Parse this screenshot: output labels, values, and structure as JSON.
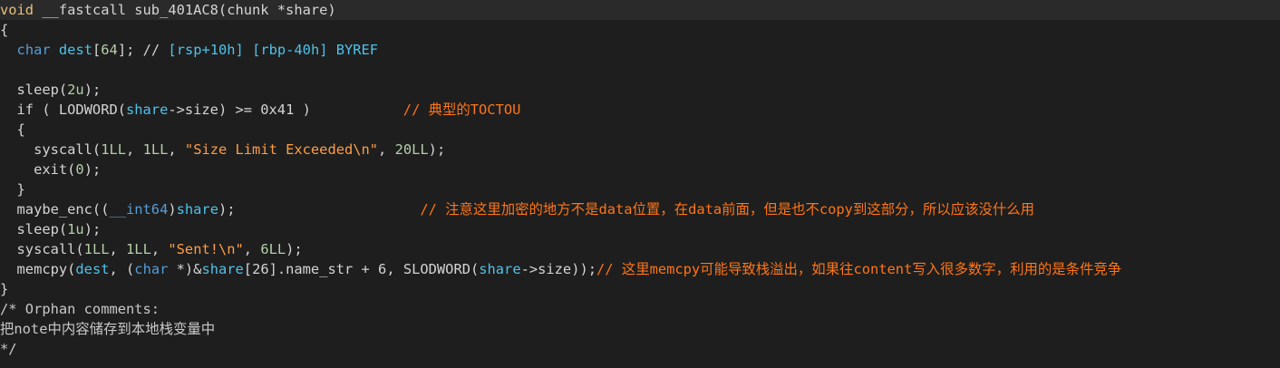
{
  "colors": {
    "background": "#1e1e1e",
    "text": "#d4d4d4",
    "keyword": "#e6c07b",
    "number": "#b5cea8",
    "identifier": "#4fc1e9",
    "string": "#ff9d45",
    "comment": "#ff7518",
    "highlight_line": "#2a2a2a"
  },
  "lines": [
    [
      [
        "kw",
        "void"
      ],
      [
        "plain",
        " __fastcall sub_401AC8(chunk *share)"
      ]
    ],
    [
      [
        "plain",
        "{"
      ]
    ],
    [
      [
        "plain",
        "  "
      ],
      [
        "type",
        "char"
      ],
      [
        "plain",
        " "
      ],
      [
        "var",
        "dest"
      ],
      [
        "plain",
        "["
      ],
      [
        "num",
        "64"
      ],
      [
        "plain",
        "]; // "
      ],
      [
        "var",
        "[rsp+10h] [rbp-40h] BYREF"
      ]
    ],
    [],
    [
      [
        "plain",
        "  sleep("
      ],
      [
        "num",
        "2u"
      ],
      [
        "plain",
        ");"
      ]
    ],
    [
      [
        "plain",
        "  if ( LODWORD("
      ],
      [
        "var",
        "share"
      ],
      [
        "plain",
        "->size) >= 0x41 )           "
      ],
      [
        "com",
        "// 典型的TOCTOU"
      ]
    ],
    [
      [
        "plain",
        "  {"
      ]
    ],
    [
      [
        "plain",
        "    syscall("
      ],
      [
        "num",
        "1LL"
      ],
      [
        "plain",
        ", "
      ],
      [
        "num",
        "1LL"
      ],
      [
        "plain",
        ", "
      ],
      [
        "str",
        "\"Size Limit Exceeded\\n\""
      ],
      [
        "plain",
        ", "
      ],
      [
        "num",
        "20LL"
      ],
      [
        "plain",
        ");"
      ]
    ],
    [
      [
        "plain",
        "    exit("
      ],
      [
        "num",
        "0"
      ],
      [
        "plain",
        ");"
      ]
    ],
    [
      [
        "plain",
        "  }"
      ]
    ],
    [
      [
        "plain",
        "  maybe_enc(("
      ],
      [
        "type",
        "__int64"
      ],
      [
        "plain",
        ")"
      ],
      [
        "var",
        "share"
      ],
      [
        "plain",
        ");                      "
      ],
      [
        "com",
        "// 注意这里加密的地方不是data位置，在data前面，但是也不copy到这部分，所以应该没什么用"
      ]
    ],
    [
      [
        "plain",
        "  sleep("
      ],
      [
        "num",
        "1u"
      ],
      [
        "plain",
        ");"
      ]
    ],
    [
      [
        "plain",
        "  syscall("
      ],
      [
        "num",
        "1LL"
      ],
      [
        "plain",
        ", "
      ],
      [
        "num",
        "1LL"
      ],
      [
        "plain",
        ", "
      ],
      [
        "str",
        "\"Sent!\\n\""
      ],
      [
        "plain",
        ", "
      ],
      [
        "num",
        "6LL"
      ],
      [
        "plain",
        ");"
      ]
    ],
    [
      [
        "plain",
        "  memcpy("
      ],
      [
        "var",
        "dest"
      ],
      [
        "plain",
        ", ("
      ],
      [
        "type",
        "char"
      ],
      [
        "plain",
        " *)&"
      ],
      [
        "var",
        "share"
      ],
      [
        "plain",
        "[26].name_str + 6, SLODWORD("
      ],
      [
        "var",
        "share"
      ],
      [
        "plain",
        "->size));"
      ],
      [
        "com",
        "// 这里memcpy可能导致栈溢出，如果往content写入很多数字，利用的是条件竞争"
      ]
    ],
    [
      [
        "plain",
        "}"
      ]
    ],
    [
      [
        "ocom",
        "/* Orphan comments:"
      ]
    ],
    [
      [
        "ocom",
        "把note中内容储存到本地栈变量中"
      ]
    ],
    [
      [
        "ocom",
        "*/"
      ]
    ]
  ]
}
